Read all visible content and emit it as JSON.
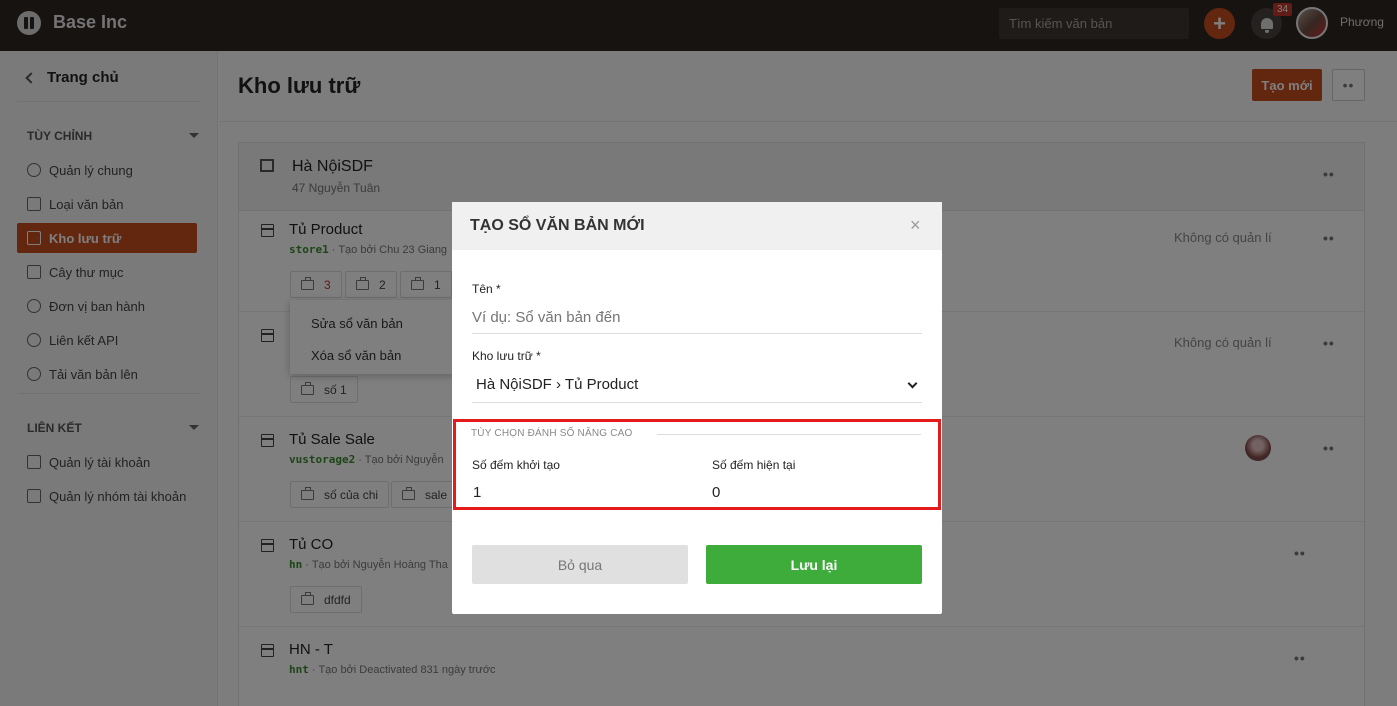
{
  "topbar": {
    "brand": "Base Inc",
    "search_placeholder": "Tìm kiếm văn bản",
    "notification_count": "34",
    "username": "Phương"
  },
  "sidebar": {
    "home": "Trang chủ",
    "section_custom": "TÙY CHỈNH",
    "custom_items": [
      {
        "label": "Quản lý chung",
        "icon": "gear-icon"
      },
      {
        "label": "Loại văn bản",
        "icon": "document-icon"
      },
      {
        "label": "Kho lưu trữ",
        "icon": "archive-icon"
      },
      {
        "label": "Cây thư mục",
        "icon": "book-icon"
      },
      {
        "label": "Đơn vị ban hành",
        "icon": "users-icon"
      },
      {
        "label": "Liên kết API",
        "icon": "api-icon"
      },
      {
        "label": "Tải văn bản lên",
        "icon": "cloud-upload-icon"
      }
    ],
    "section_links": "LIÊN KẾT",
    "link_items": [
      {
        "label": "Quản lý tài khoản",
        "icon": "external-link-icon"
      },
      {
        "label": "Quản lý nhóm tài khoản",
        "icon": "external-link-icon"
      }
    ]
  },
  "main": {
    "title": "Kho lưu trữ",
    "create_button": "Tạo mới",
    "location": {
      "name": "Hà NộiSDF",
      "address": "47 Nguyễn Tuân"
    },
    "cabinets": [
      {
        "name": "Tủ Product",
        "code": "store1",
        "meta": " · Tạo bởi Chu 23 Giang",
        "manager": "Không có quản lí",
        "chips": [
          "3",
          "2",
          "1"
        ]
      },
      {
        "name": "",
        "code": "",
        "meta": "",
        "manager": "Không có quản lí",
        "chips": [
          "số 1"
        ]
      },
      {
        "name": "Tủ Sale Sale",
        "code": "vustorage2",
        "meta": " · Tạo bởi Nguyễn",
        "manager": "",
        "chips": [
          "số của chi",
          "sale"
        ]
      },
      {
        "name": "Tủ CO",
        "code": "hn",
        "meta": " · Tạo bởi Nguyễn Hoàng Tha",
        "manager": "",
        "chips": [
          "dfdfd"
        ]
      },
      {
        "name": "HN - T",
        "code": "hnt",
        "meta": " · Tạo bởi Deactivated 831 ngày trước",
        "manager": "",
        "chips": []
      }
    ],
    "context_menu": [
      "Sửa sổ văn bản",
      "Xóa sổ văn bản"
    ]
  },
  "modal": {
    "title": "TẠO SỔ VĂN BẢN MỚI",
    "close": "×",
    "name_label": "Tên *",
    "name_placeholder": "Ví dụ: Sổ văn bản đến",
    "storage_label": "Kho lưu trữ *",
    "storage_value": "Hà NộiSDF › Tủ Product",
    "advanced_title": "TÙY CHỌN ĐÁNH SỐ NÂNG CAO",
    "start_count_label": "Số đếm khởi tạo",
    "start_count_value": "1",
    "current_count_label": "Số đếm hiện tại",
    "current_count_value": "0",
    "cancel_button": "Bỏ qua",
    "save_button": "Lưu lại"
  },
  "colors": {
    "brand_accent": "#c64e21",
    "save_green": "#3dac3a",
    "highlight_red": "#e31b1b",
    "topbar_bg": "#2e2622"
  }
}
